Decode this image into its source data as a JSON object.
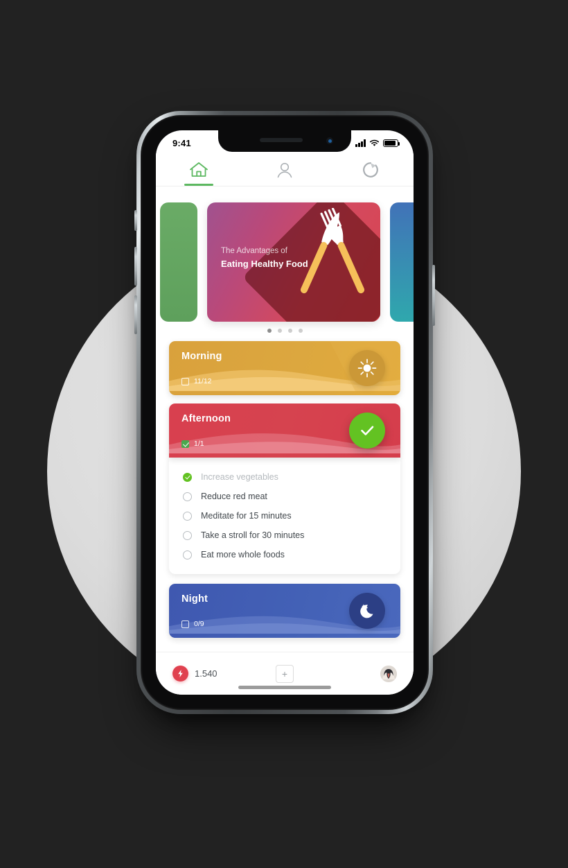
{
  "scene": {
    "background_color": "#222222",
    "backdrop_circle_color": "#dcdcdc"
  },
  "phone": {
    "status_bar": {
      "time": "9:41",
      "signal_icon": "cellular-signal-icon",
      "wifi_icon": "wifi-icon",
      "battery_icon": "battery-icon"
    },
    "notch": {
      "speaker_icon": "speaker-grille-icon",
      "camera_icon": "front-camera-icon"
    },
    "home_indicator": "home-indicator"
  },
  "tabs": [
    {
      "id": "home",
      "icon": "home-icon",
      "label": "Home",
      "active": true,
      "color": "#5cb860"
    },
    {
      "id": "profile",
      "icon": "person-icon",
      "label": "Profile",
      "active": false,
      "color": "#a9aeb2"
    },
    {
      "id": "progress",
      "icon": "progress-ring-icon",
      "label": "Progress",
      "active": false,
      "color": "#a9aeb2"
    }
  ],
  "carousel": {
    "slides": [
      {
        "id": "prev",
        "color": "#5ea05c",
        "partial": true
      },
      {
        "id": "healthy-food",
        "subtitle": "The Advantages of",
        "title": "Eating Healthy Food",
        "art": "fork-and-knife-icon",
        "gradient_from": "#a0528f",
        "gradient_to": "#d9444f",
        "active": true
      },
      {
        "id": "next",
        "color": "#2fa8ad",
        "partial": true
      }
    ],
    "dots": {
      "count": 4,
      "active_index": 0,
      "active_color": "#8e8e8e",
      "inactive_color": "#cfcfcf"
    }
  },
  "sections": [
    {
      "id": "morning",
      "label": "Morning",
      "progress": "11/12",
      "checked": false,
      "badge_icon": "sun-icon",
      "color": "#d9a13c",
      "badge_color": "#cb9837",
      "expanded": false
    },
    {
      "id": "afternoon",
      "label": "Afternoon",
      "progress": "1/1",
      "checked": true,
      "badge_icon": "check-circle-icon",
      "color": "#d8404f",
      "badge_color": "#63c222",
      "expanded": true,
      "tasks": [
        {
          "label": "Increase vegetables",
          "done": true
        },
        {
          "label": "Reduce red meat",
          "done": false
        },
        {
          "label": "Meditate for 15 minutes",
          "done": false
        },
        {
          "label": "Take a stroll for 30 minutes",
          "done": false
        },
        {
          "label": "Eat more whole foods",
          "done": false
        }
      ]
    },
    {
      "id": "night",
      "label": "Night",
      "progress": "0/9",
      "checked": false,
      "badge_icon": "moon-stars-icon",
      "color": "#3f58b0",
      "badge_color": "#2c3f85",
      "expanded": false
    }
  ],
  "bottom_bar": {
    "points_icon": "lightning-bolt-icon",
    "points_value": "1.540",
    "points_color": "#e0414f",
    "add_button_label": "+",
    "avatar_icon": "user-avatar"
  }
}
